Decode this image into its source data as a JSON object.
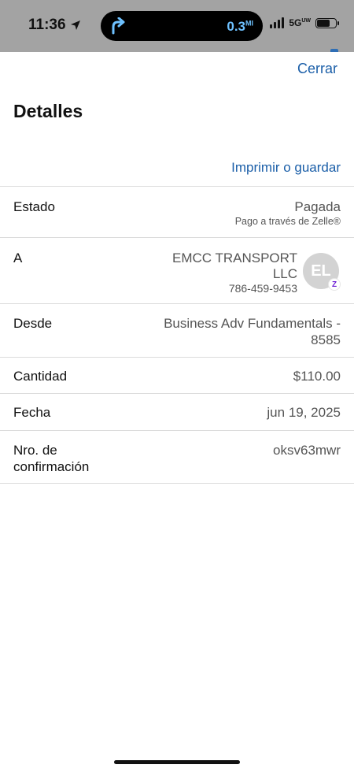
{
  "status_bar": {
    "time": "11:36",
    "island_distance": "0.3",
    "island_unit": "MI",
    "network": "5G",
    "network_sup": "UW"
  },
  "header": {
    "close_label": "Cerrar",
    "title": "Detalles",
    "print_label": "Imprimir o guardar"
  },
  "details": {
    "status": {
      "label": "Estado",
      "value": "Pagada",
      "note": "Pago a través de Zelle®"
    },
    "to": {
      "label": "A",
      "name_line1": "EMCC TRANSPORT",
      "name_line2": "LLC",
      "phone": "786-459-9453",
      "avatar_initials": "EL",
      "badge": "Z"
    },
    "from": {
      "label": "Desde",
      "value_line1": "Business Adv Fundamentals -",
      "value_line2": "8585"
    },
    "amount": {
      "label": "Cantidad",
      "value": "$110.00"
    },
    "date": {
      "label": "Fecha",
      "value": "jun 19, 2025"
    },
    "confirmation": {
      "label_line1": "Nro. de",
      "label_line2": "confirmación",
      "value": "oksv63mwr"
    }
  },
  "colors": {
    "link": "#1a5ea8",
    "zelle": "#6d1ed4",
    "status_bar_bg": "#a3a3a3"
  }
}
